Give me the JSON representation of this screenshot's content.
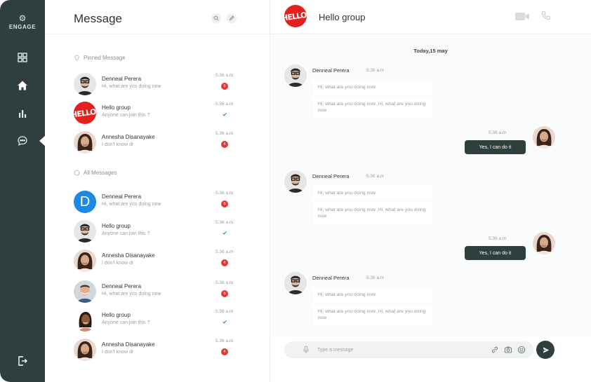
{
  "app": {
    "brand": "ENGAGE"
  },
  "list": {
    "title": "Message",
    "pinned_label": "Pinned Message",
    "all_label": "All Messages",
    "pinned": [
      {
        "name": "Denneal Perera",
        "preview": "Hi, what are you doing now",
        "time": "5.36 a.m",
        "badge": "6",
        "status": "unread",
        "avatar": "man-glasses"
      },
      {
        "name": "Hello group",
        "preview": "Anyone can join this ?",
        "time": "5.36 a.m",
        "badge": "",
        "status": "read",
        "avatar": "hello-logo",
        "avatar_text": "HELLO!"
      },
      {
        "name": "Annesha Disanayake",
        "preview": "I don't know dr",
        "time": "5.36 a.m",
        "badge": "4",
        "status": "unread",
        "avatar": "woman"
      }
    ],
    "all": [
      {
        "name": "Denneal Perera",
        "preview": "Hi, what are you doing now",
        "time": "5.36 a.m",
        "badge": "6",
        "status": "unread",
        "avatar": "letter",
        "avatar_text": "D"
      },
      {
        "name": "Hello group",
        "preview": "Anyone can join this ?",
        "time": "5.36 a.m",
        "badge": "",
        "status": "read",
        "avatar": "man-glasses"
      },
      {
        "name": "Annesha Disanayake",
        "preview": "I don't know dr",
        "time": "5.36 a.m",
        "badge": "4",
        "status": "unread",
        "avatar": "woman"
      },
      {
        "name": "Denneal Perera",
        "preview": "Hi, what are you doing now",
        "time": "5.36 a.m",
        "badge": "6",
        "status": "unread",
        "avatar": "man-smiling"
      },
      {
        "name": "Hello group",
        "preview": "Anyone can join this ?",
        "time": "5.36 a.m",
        "badge": "",
        "status": "read",
        "avatar": "woman-2"
      },
      {
        "name": "Annesha Disanayake",
        "preview": "I don't know dr",
        "time": "5.36 a.m",
        "badge": "4",
        "status": "unread",
        "avatar": "woman"
      }
    ]
  },
  "chat": {
    "title": "Hello group",
    "group_avatar_text": "HELLO!",
    "date_label": "Today,15 may",
    "groups": [
      {
        "in_name": "Denneal Perera",
        "in_time": "5.36 a.m",
        "in_messages": [
          "Hi, what are you doing now",
          "Hi, what are you doing now ,Hi, what are you doing now"
        ],
        "out_time": "5.36 a.m",
        "out_text": "Yes, I can do it"
      },
      {
        "in_name": "Denneal Perera",
        "in_time": "5.36 a.m",
        "in_messages": [
          "Hi, what are you doing now",
          "Hi, what are you doing now ,Hi, what are you doing now"
        ],
        "out_time": "5.36 a.m",
        "out_text": "Yes, I can do it"
      },
      {
        "in_name": "Denneal Perera",
        "in_time": "5.36 a.m",
        "in_messages": [
          "Hi, what are you doing now",
          "Hi, what are you doing now ,Hi, what are you doing now"
        ]
      }
    ],
    "composer": {
      "placeholder": "Type a message"
    }
  },
  "colors": {
    "sidebar": "#2f3f3d",
    "badge": "#e53935",
    "check": "#2fb36b",
    "out_bubble": "#2f3f3d",
    "group_red": "#e3201b"
  },
  "icons": [
    "gear-icon",
    "dashboard-icon",
    "home-icon",
    "bar-chart-icon",
    "chat-icon",
    "logout-icon",
    "search-icon",
    "edit-icon",
    "pin-icon",
    "video-icon",
    "phone-icon",
    "mic-icon",
    "link-icon",
    "camera-icon",
    "emoji-icon",
    "send-icon"
  ]
}
